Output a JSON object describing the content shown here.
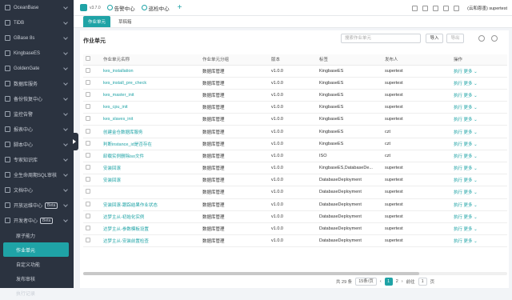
{
  "sidebar": {
    "items": [
      {
        "label": "OceanBase"
      },
      {
        "label": "TiDB"
      },
      {
        "label": "GBase 8s"
      },
      {
        "label": "KingbaseES"
      },
      {
        "label": "GoldenGate"
      },
      {
        "label": "数据库服务"
      },
      {
        "label": "备份恢复中心"
      },
      {
        "label": "监控告警"
      },
      {
        "label": "报表中心"
      },
      {
        "label": "脚本中心"
      },
      {
        "label": "专家知识库"
      },
      {
        "label": "全生命周期SQL审核"
      },
      {
        "label": "文档中心"
      },
      {
        "label": "开放运维中心",
        "tag": "Beta"
      },
      {
        "label": "开发者中心",
        "tag": "Beta"
      }
    ],
    "sub_items": [
      {
        "label": "原子能力"
      },
      {
        "label": "作业单元"
      },
      {
        "label": "自定义功能"
      },
      {
        "label": "发布审核"
      },
      {
        "label": "执行记录"
      }
    ]
  },
  "topbar": {
    "version": "v3.7.0",
    "nav1": "告警中心",
    "nav2": "巡检中心",
    "plus": "+",
    "user": "(云和恩墨) supertest"
  },
  "tabs": [
    {
      "label": "作业单元"
    },
    {
      "label": "草稿箱"
    }
  ],
  "main": {
    "title": "作业单元",
    "search_placeholder": "搜索作业单元",
    "import_label": "导入",
    "export_label": "导出"
  },
  "table": {
    "headers": [
      "作业单元名称",
      "作业单元分组",
      "版本",
      "标签",
      "发布人",
      "操作"
    ],
    "rows": [
      {
        "name": "kes_installation",
        "group": "数据库管理",
        "version": "v1.0.0",
        "tag": "KingbaseES",
        "publisher": "supertest"
      },
      {
        "name": "kes_install_pre_check",
        "group": "数据库管理",
        "version": "v1.0.0",
        "tag": "KingbaseES",
        "publisher": "supertest"
      },
      {
        "name": "kes_master_init",
        "group": "数据库管理",
        "version": "v1.0.0",
        "tag": "KingbaseES",
        "publisher": "supertest"
      },
      {
        "name": "kes_cpu_init",
        "group": "数据库管理",
        "version": "v1.0.0",
        "tag": "KingbaseES",
        "publisher": "supertest"
      },
      {
        "name": "kes_slaves_init",
        "group": "数据库管理",
        "version": "v1.0.0",
        "tag": "KingbaseES",
        "publisher": "supertest"
      },
      {
        "name": "创建金仓数据库服务",
        "group": "数据库管理",
        "version": "v1.0.0",
        "tag": "KingbaseES",
        "publisher": "czt"
      },
      {
        "name": "判断instance_id是否存在",
        "group": "数据库管理",
        "version": "v1.0.0",
        "tag": "KingbaseES",
        "publisher": "czt"
      },
      {
        "name": "卸载实例删除iso文件",
        "group": "数据库管理",
        "version": "v1.0.0",
        "tag": "ISO",
        "publisher": "czt"
      },
      {
        "name": "安装回滚",
        "group": "数据库管理",
        "version": "v1.0.0",
        "tag": "KingbaseES,DatabaseDe...",
        "publisher": "supertest"
      },
      {
        "name": "安装回滚",
        "group": "数据库管理",
        "version": "v1.0.0",
        "tag": "DatabaseDeployment",
        "publisher": "supertest"
      },
      {
        "name": "",
        "group": "数据库管理",
        "version": "v1.0.0",
        "tag": "DatabaseDeployment",
        "publisher": "supertest"
      },
      {
        "name": "安装回滚-跟踪结果作业状态",
        "group": "数据库管理",
        "version": "v1.0.0",
        "tag": "DatabaseDeployment",
        "publisher": "supertest"
      },
      {
        "name": "达梦主从-初始化实例",
        "group": "数据库管理",
        "version": "v1.0.0",
        "tag": "DatabaseDeployment",
        "publisher": "supertest"
      },
      {
        "name": "达梦主从-参数模板设置",
        "group": "数据库管理",
        "version": "v1.0.0",
        "tag": "DatabaseDeployment",
        "publisher": "supertest"
      },
      {
        "name": "达梦主从-安装前置检查",
        "group": "数据库管理",
        "version": "v1.0.0",
        "tag": "DatabaseDeployment",
        "publisher": "supertest"
      }
    ],
    "op_run": "执行",
    "op_more": "更多"
  },
  "pager": {
    "total": "共 29 条",
    "page_size": "15条/页",
    "current": "1",
    "next": "2",
    "goto_label": "前往",
    "goto_value": "1",
    "page_suffix": "页"
  }
}
